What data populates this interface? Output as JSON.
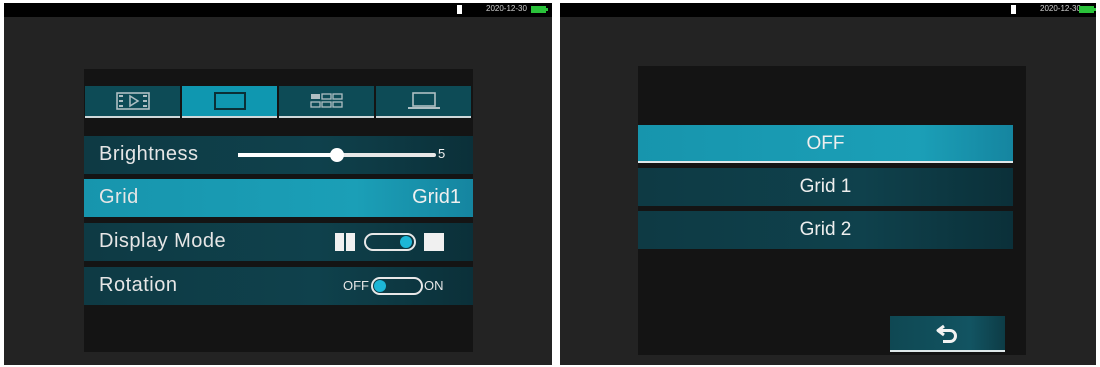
{
  "left_screen": {
    "status": {
      "date": "2020-12-30"
    },
    "tabs": [
      {
        "icon": "video-icon",
        "active": false
      },
      {
        "icon": "display-icon",
        "active": true
      },
      {
        "icon": "grid-icon",
        "active": false
      },
      {
        "icon": "laptop-icon",
        "active": false
      }
    ],
    "menu": {
      "brightness": {
        "label": "Brightness",
        "value": "5",
        "level_fraction": 0.5
      },
      "grid": {
        "label": "Grid",
        "value": "Grid1"
      },
      "display_mode": {
        "label": "Display Mode"
      },
      "rotation": {
        "label": "Rotation",
        "off_label": "OFF",
        "on_label": "ON"
      }
    }
  },
  "right_screen": {
    "status": {
      "date": "2020-12-30"
    },
    "options": [
      {
        "label": "OFF",
        "selected": true
      },
      {
        "label": "Grid 1",
        "selected": false
      },
      {
        "label": "Grid 2",
        "selected": false
      }
    ],
    "back_icon": "return-icon"
  },
  "colors": {
    "accent": "#1b9fb7",
    "row": "#0e3a44",
    "battery": "#2ac23a"
  }
}
